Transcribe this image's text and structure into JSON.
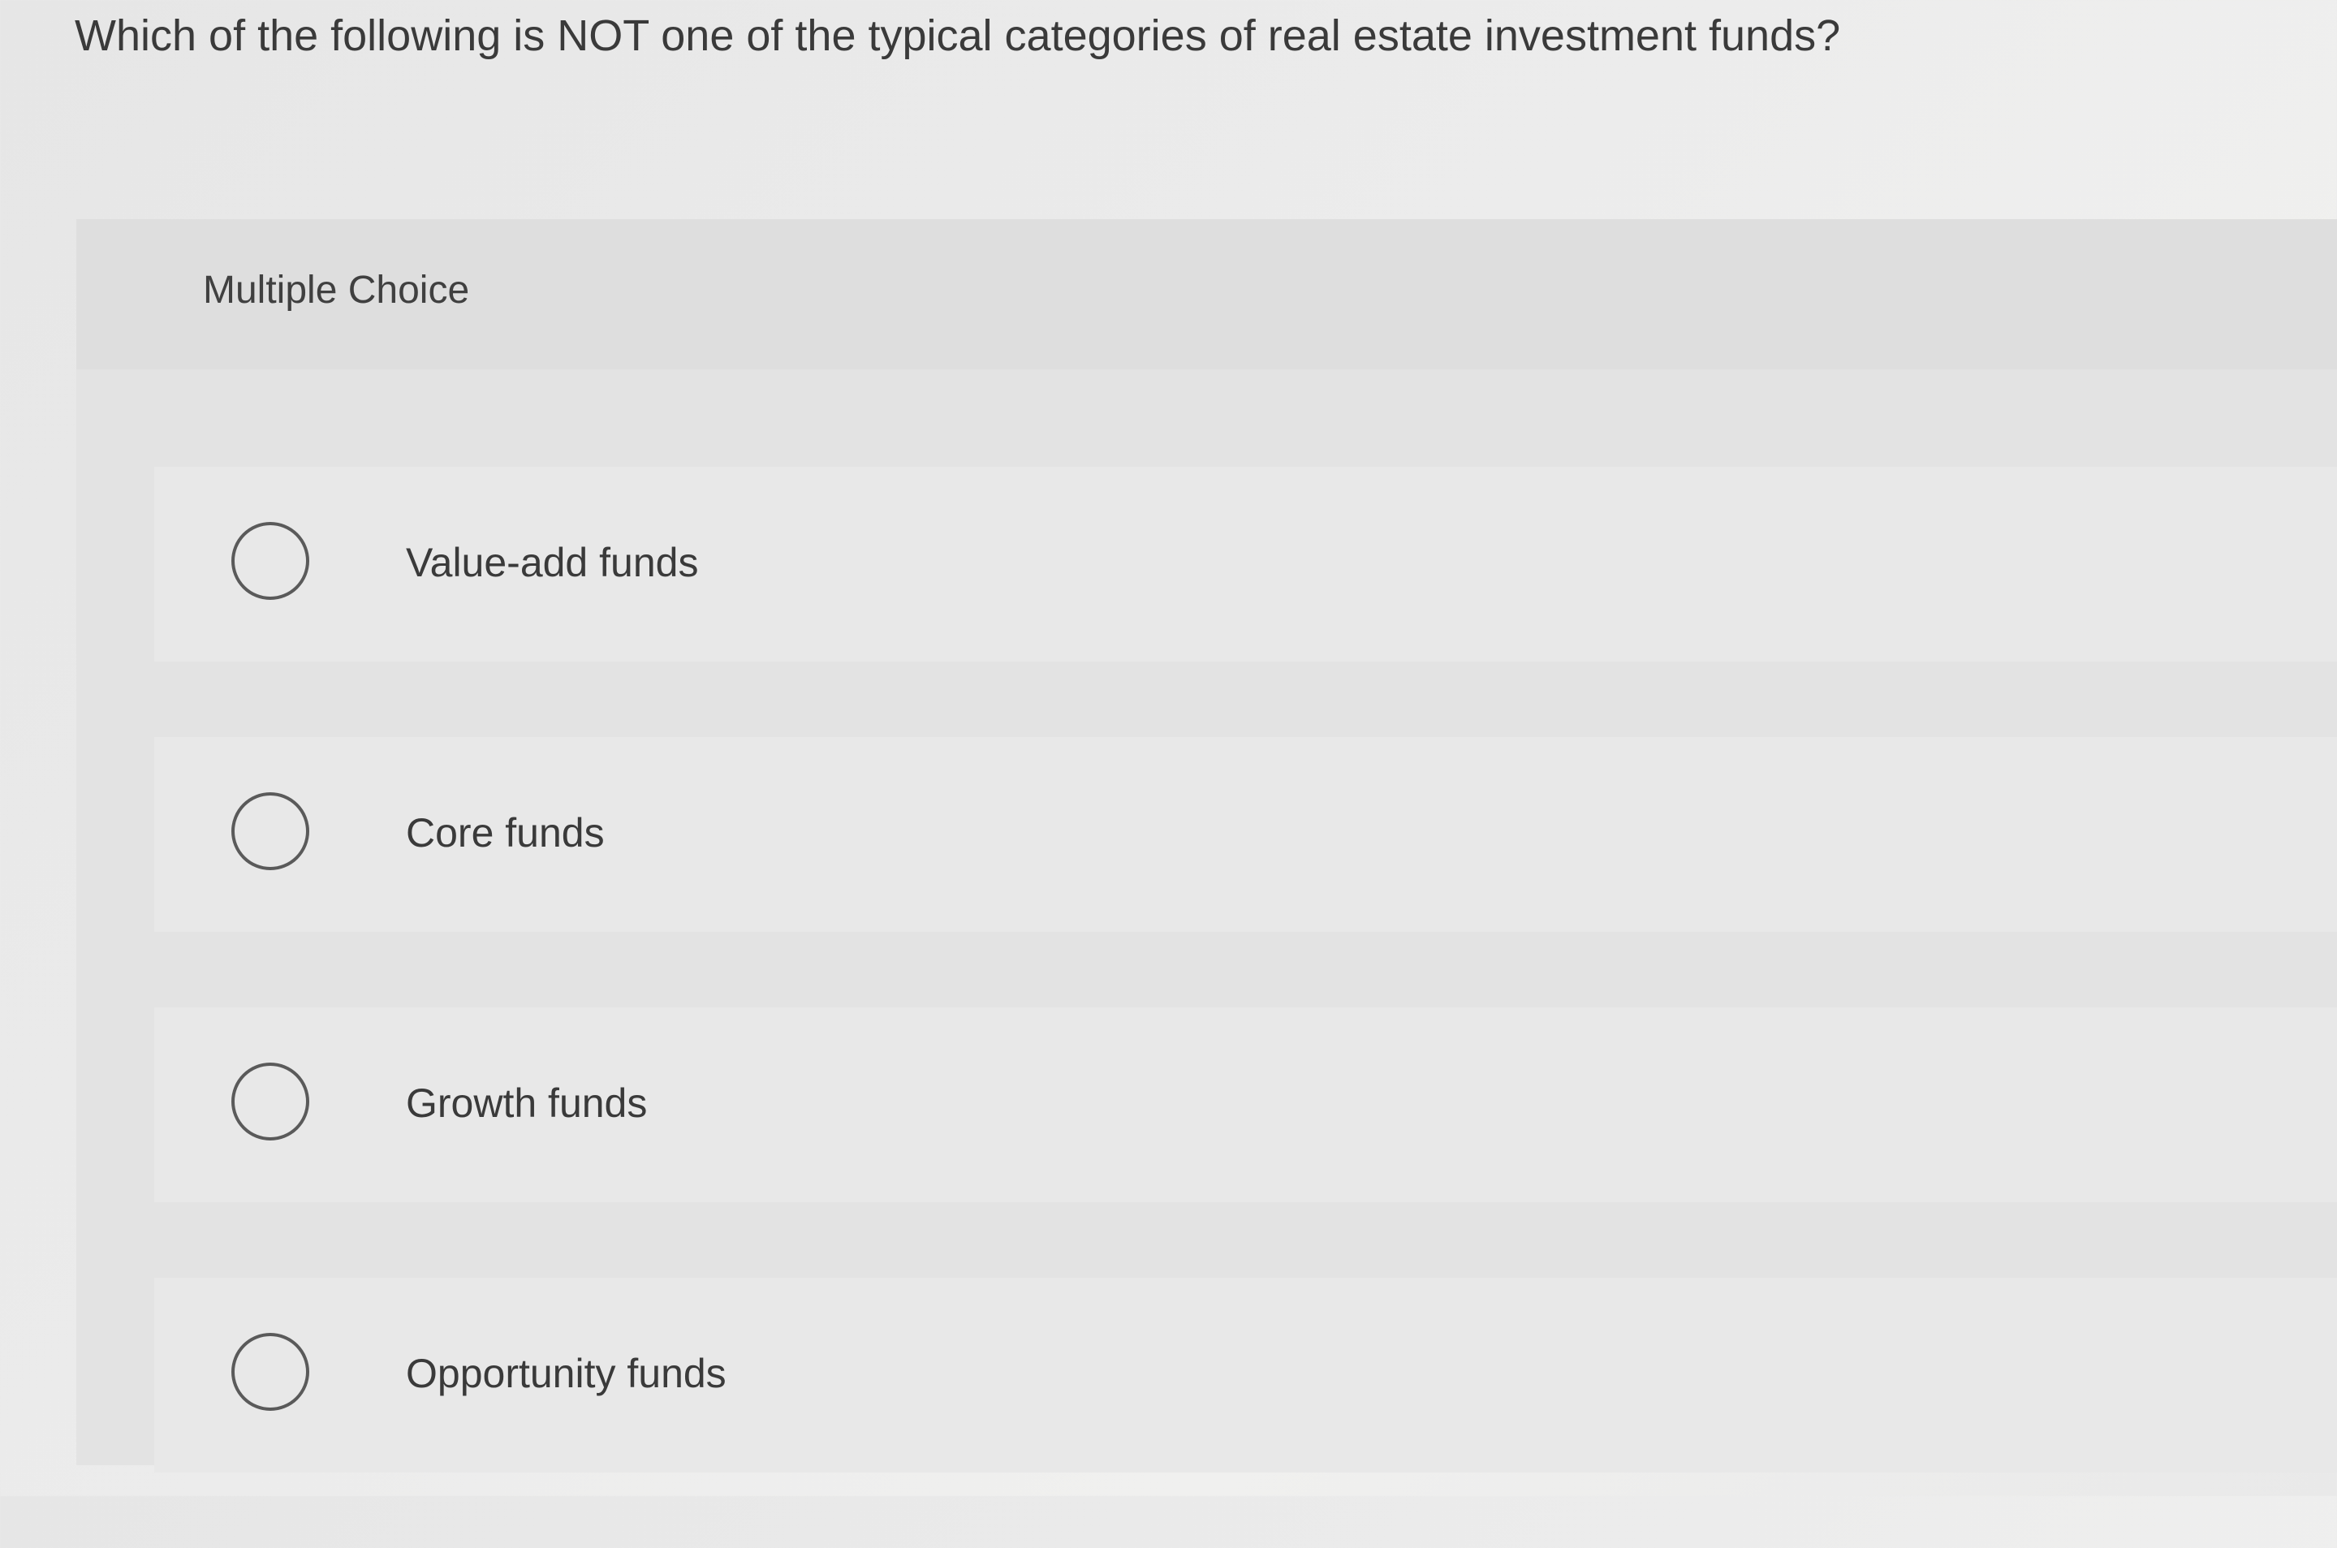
{
  "question": {
    "text": "Which of the following is NOT one of the typical categories of real estate investment funds?"
  },
  "panel": {
    "type_label": "Multiple Choice"
  },
  "options": [
    {
      "label": "Value-add funds",
      "selected": false
    },
    {
      "label": "Core funds",
      "selected": false
    },
    {
      "label": "Growth funds",
      "selected": false
    },
    {
      "label": "Opportunity funds",
      "selected": false
    }
  ],
  "colors": {
    "background": "#e9e9e9",
    "text": "#3a3a3a",
    "radio_border": "#5a5a5a"
  }
}
